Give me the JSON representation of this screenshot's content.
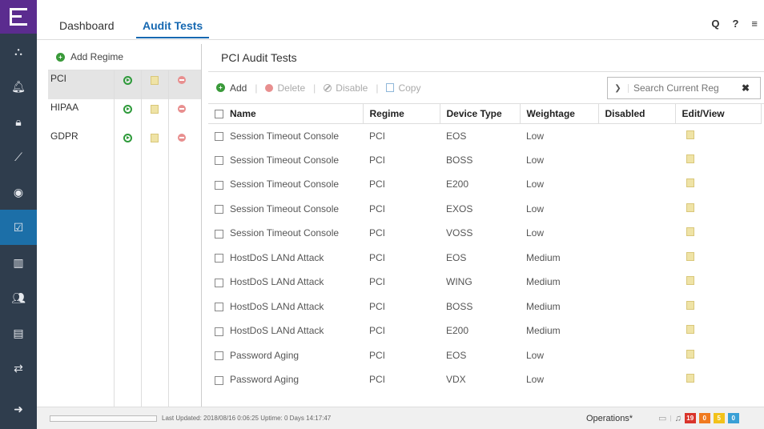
{
  "app": {
    "logo_letter": "E",
    "nav_icons": [
      "network-icon",
      "alarm-icon",
      "lock-icon",
      "analytics-icon",
      "wireless-icon",
      "compliance-icon",
      "reports-icon",
      "users-icon",
      "inventory-icon",
      "tasks-icon"
    ],
    "bottom_icon": "arrow-right-icon"
  },
  "tabs": [
    {
      "label": "Dashboard",
      "active": false
    },
    {
      "label": "Audit Tests",
      "active": true
    }
  ],
  "top_icons": {
    "search": "Q",
    "help": "?",
    "menu": "≡"
  },
  "regimes": {
    "add_label": "Add Regime",
    "items": [
      {
        "name": "PCI",
        "selected": true
      },
      {
        "name": "HIPAA",
        "selected": false
      },
      {
        "name": "GDPR",
        "selected": false
      }
    ]
  },
  "main": {
    "title": "PCI Audit Tests",
    "toolbar": {
      "add": "Add",
      "delete": "Delete",
      "disable": "Disable",
      "copy": "Copy",
      "search_placeholder": "Search Current Reg"
    },
    "columns": [
      "Name",
      "Regime",
      "Device Type",
      "Weightage",
      "Disabled",
      "Edit/View"
    ],
    "rows": [
      {
        "name": "Session Timeout Console",
        "regime": "PCI",
        "device": "EOS",
        "weight": "Low",
        "disabled": ""
      },
      {
        "name": "Session Timeout Console",
        "regime": "PCI",
        "device": "BOSS",
        "weight": "Low",
        "disabled": ""
      },
      {
        "name": "Session Timeout Console",
        "regime": "PCI",
        "device": "E200",
        "weight": "Low",
        "disabled": ""
      },
      {
        "name": "Session Timeout Console",
        "regime": "PCI",
        "device": "EXOS",
        "weight": "Low",
        "disabled": ""
      },
      {
        "name": "Session Timeout Console",
        "regime": "PCI",
        "device": "VOSS",
        "weight": "Low",
        "disabled": ""
      },
      {
        "name": "HostDoS LANd Attack",
        "regime": "PCI",
        "device": "EOS",
        "weight": "Medium",
        "disabled": ""
      },
      {
        "name": "HostDoS LANd Attack",
        "regime": "PCI",
        "device": "WING",
        "weight": "Medium",
        "disabled": ""
      },
      {
        "name": "HostDoS LANd Attack",
        "regime": "PCI",
        "device": "BOSS",
        "weight": "Medium",
        "disabled": ""
      },
      {
        "name": "HostDoS LANd Attack",
        "regime": "PCI",
        "device": "E200",
        "weight": "Medium",
        "disabled": ""
      },
      {
        "name": "Password Aging",
        "regime": "PCI",
        "device": "EOS",
        "weight": "Low",
        "disabled": ""
      },
      {
        "name": "Password Aging",
        "regime": "PCI",
        "device": "VDX",
        "weight": "Low",
        "disabled": ""
      }
    ]
  },
  "status": {
    "last_updated": "Last Updated: 2018/08/16 0:06:25   Uptime: 0 Days 14:17:47",
    "operations": "Operations*",
    "badges": [
      {
        "value": "19",
        "color": "#d9342b"
      },
      {
        "value": "0",
        "color": "#f07a1f"
      },
      {
        "value": "5",
        "color": "#f2c21b"
      },
      {
        "value": "0",
        "color": "#3aa0d6"
      }
    ]
  }
}
